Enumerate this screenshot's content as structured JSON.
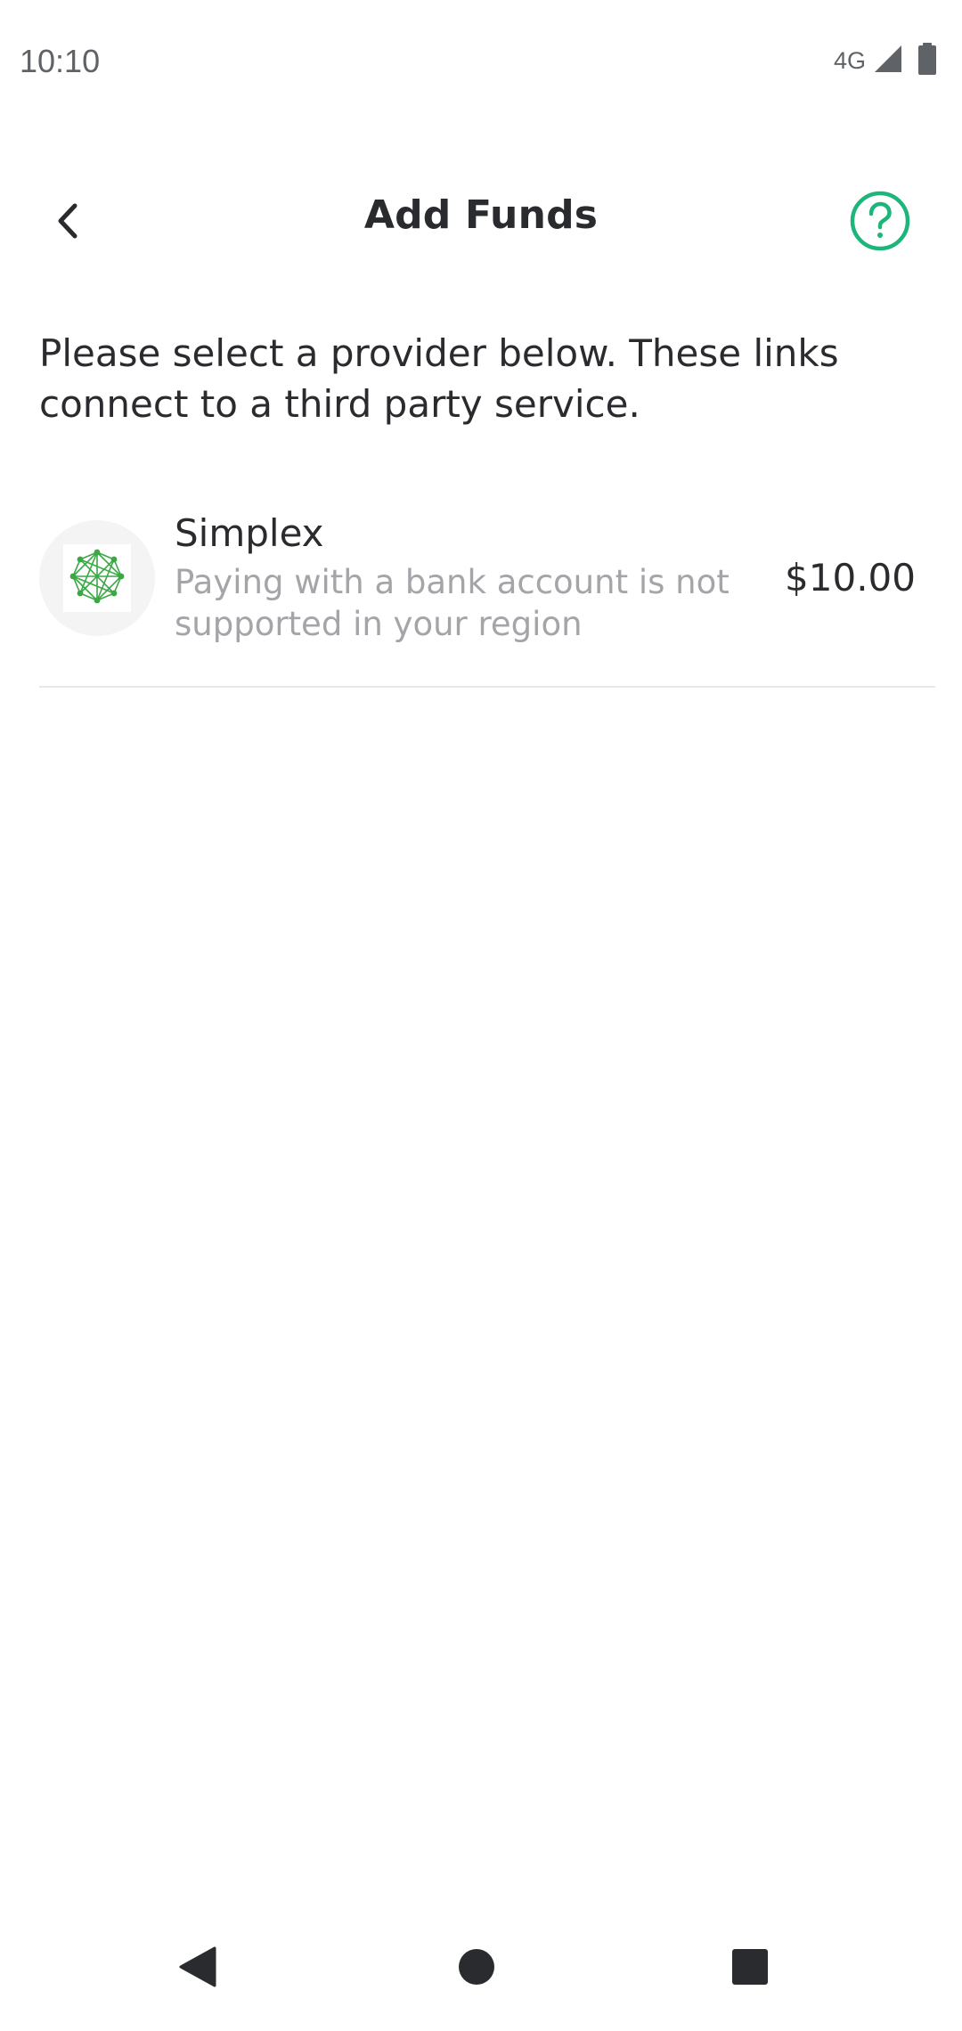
{
  "status_bar": {
    "time": "10:10",
    "network": "4G",
    "icons": [
      "signal-icon",
      "battery-icon"
    ]
  },
  "header": {
    "title": "Add Funds",
    "back_icon": "chevron-left-icon",
    "help_icon": "help-circle-icon"
  },
  "intro_text": "Please select a provider below. These links connect to a third party service.",
  "providers": [
    {
      "name": "Simplex",
      "note": "Paying with a bank account is not supported in your region",
      "price": "$10.00",
      "logo_icon": "simplex-logo-icon"
    }
  ],
  "nav": {
    "icons": [
      "nav-back-icon",
      "nav-home-icon",
      "nav-recents-icon"
    ]
  },
  "colors": {
    "accent": "#1db57a",
    "simplex_green": "#3aa845",
    "text_primary": "#2a2b2e",
    "text_secondary": "#a3a5a8",
    "divider": "#e6e7e8",
    "nav_icon": "#2a2b2e"
  }
}
